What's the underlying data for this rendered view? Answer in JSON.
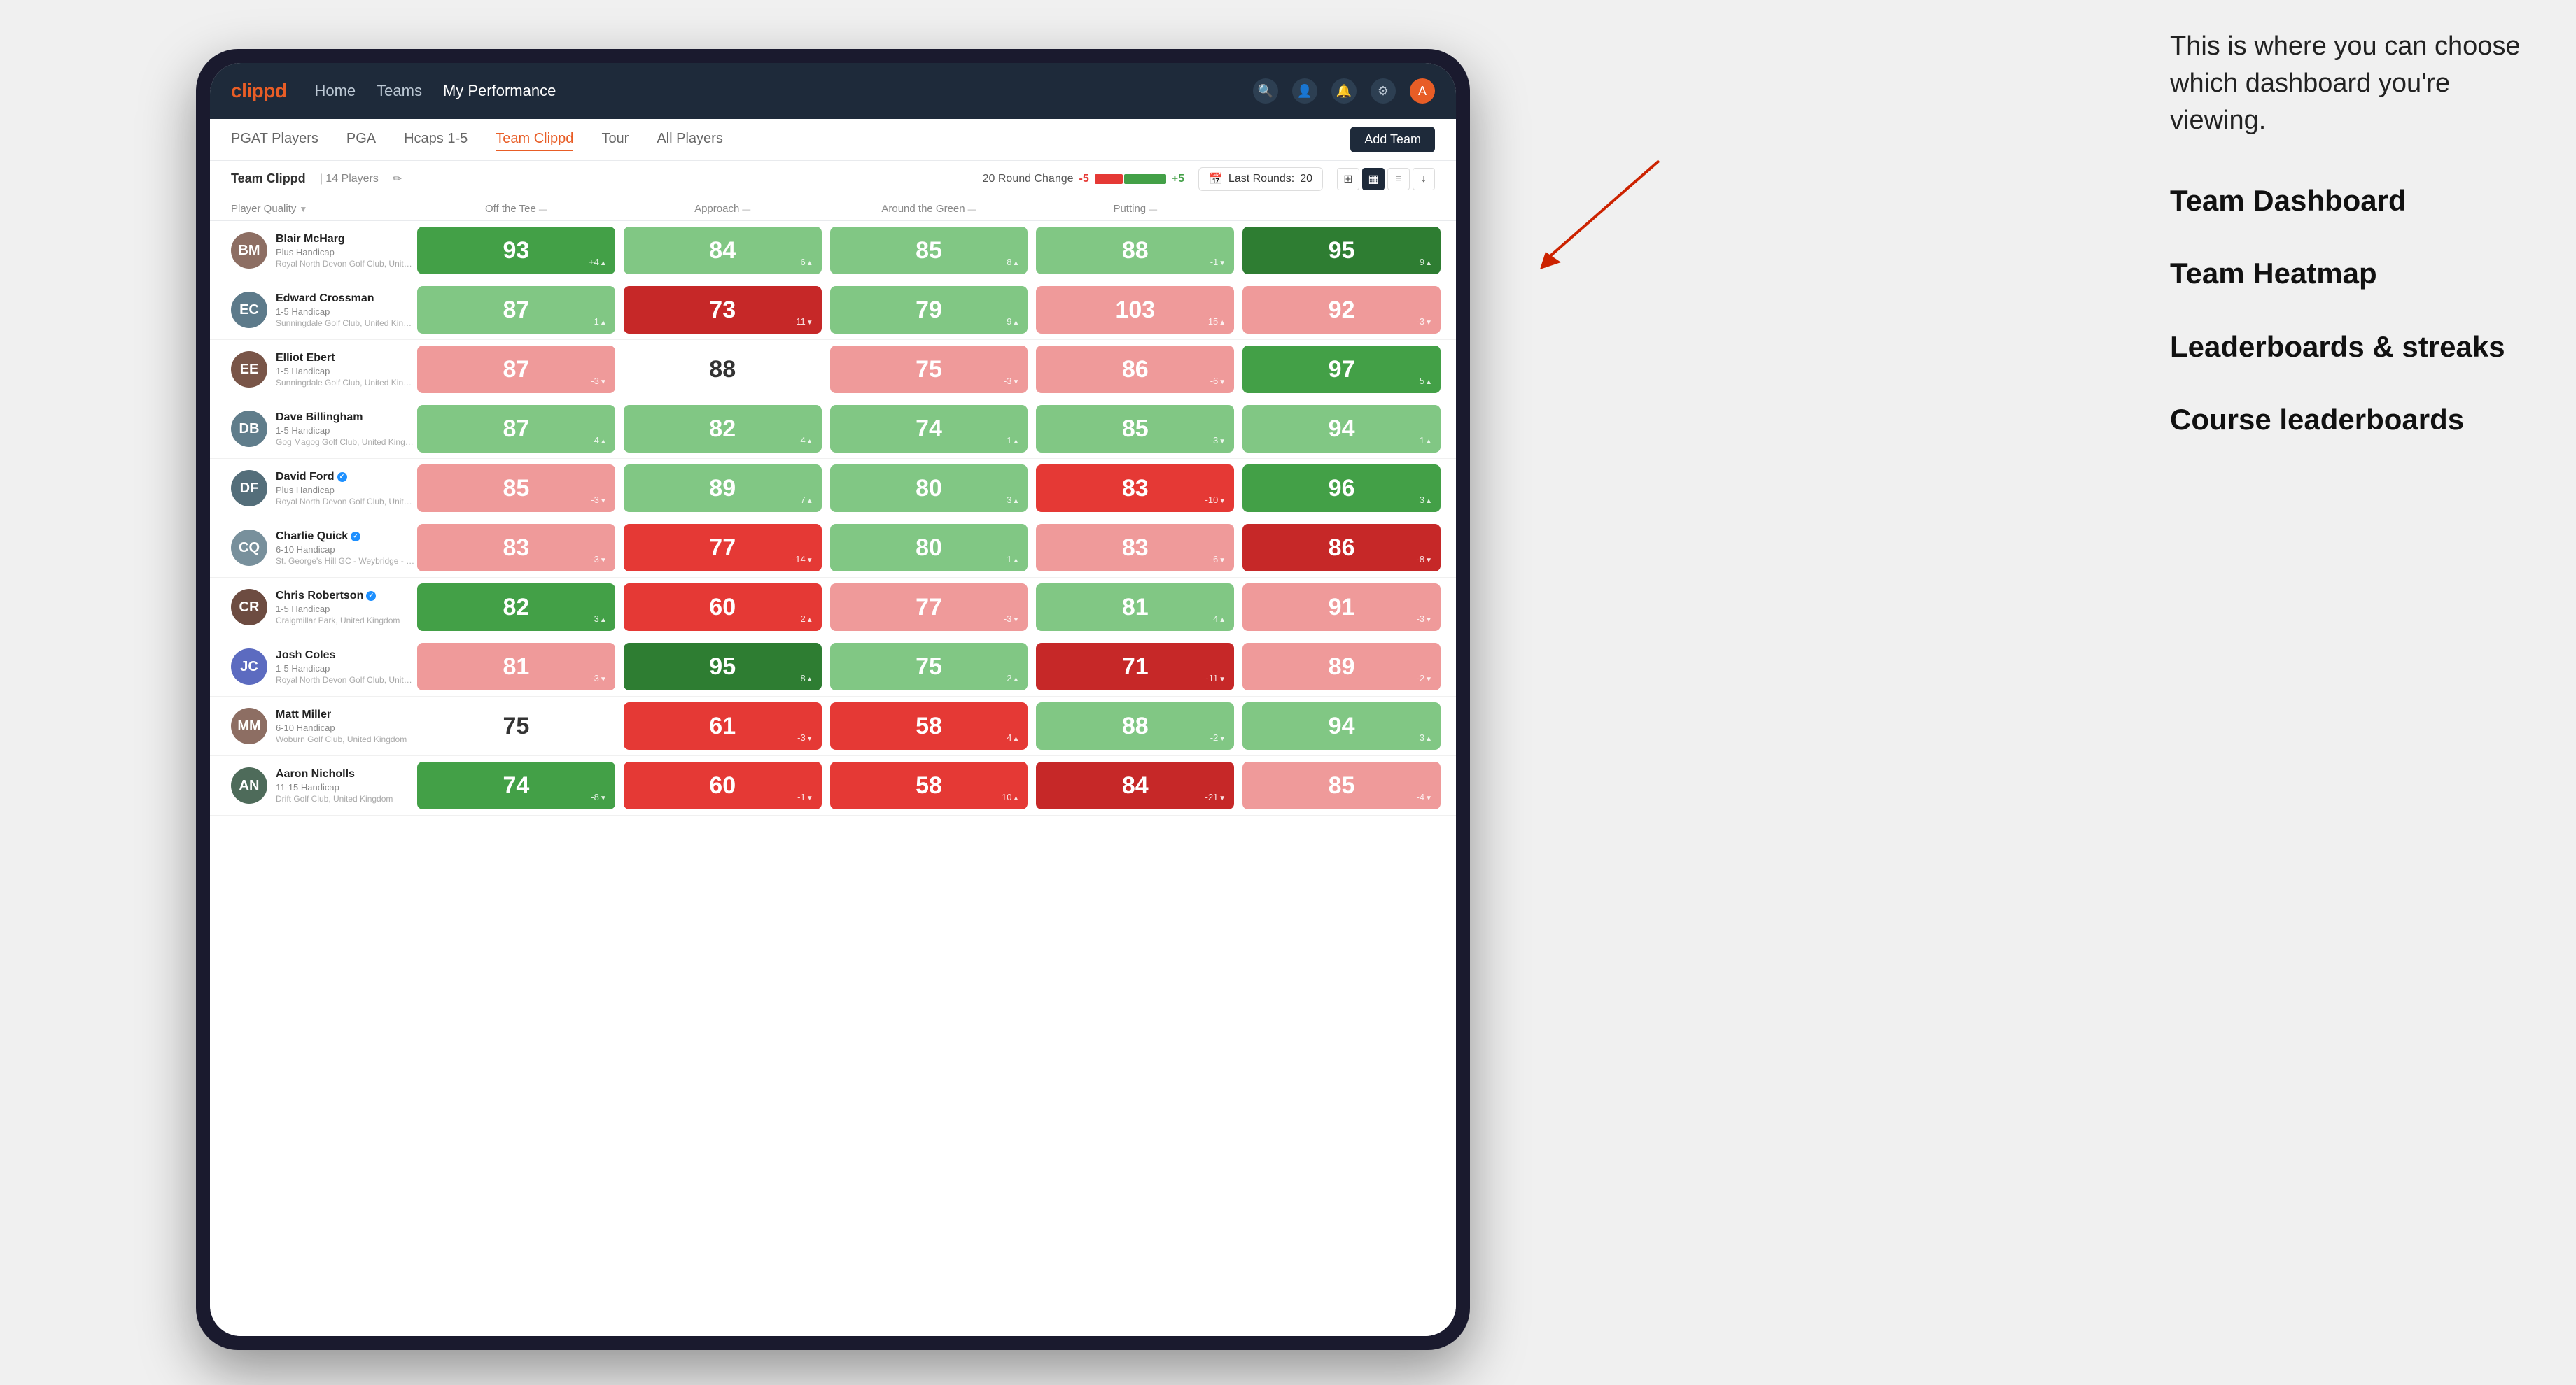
{
  "annotation": {
    "intro": "This is where you can choose which dashboard you're viewing.",
    "options": [
      "Team Dashboard",
      "Team Heatmap",
      "Leaderboards & streaks",
      "Course leaderboards"
    ]
  },
  "nav": {
    "logo": "clippd",
    "items": [
      "Home",
      "Teams",
      "My Performance"
    ],
    "active": "My Performance"
  },
  "sub_nav": {
    "items": [
      "PGAT Players",
      "PGA",
      "Hcaps 1-5",
      "Team Clippd",
      "Tour",
      "All Players"
    ],
    "active": "Team Clippd",
    "add_team_label": "Add Team"
  },
  "team_bar": {
    "name": "Team Clippd",
    "separator": "|",
    "count": "14 Players",
    "round_change_label": "20 Round Change",
    "neg_label": "-5",
    "pos_label": "+5",
    "last_rounds_label": "Last Rounds:",
    "last_rounds_value": "20"
  },
  "columns": [
    "Player Quality ↓",
    "Off the Tee ↓",
    "Approach ↓",
    "Around the Green ↓",
    "Putting ↓"
  ],
  "players": [
    {
      "name": "Blair McHarg",
      "handicap": "Plus Handicap",
      "club": "Royal North Devon Golf Club, United Kingdom",
      "avatar_color": "#8d6e63",
      "initials": "BM",
      "scores": [
        {
          "value": 93,
          "change": "+4",
          "dir": "up",
          "bg": "green-med"
        },
        {
          "value": 84,
          "change": "6",
          "dir": "up",
          "bg": "green-light"
        },
        {
          "value": 85,
          "change": "8",
          "dir": "up",
          "bg": "green-light"
        },
        {
          "value": 88,
          "change": "-1",
          "dir": "down",
          "bg": "green-light"
        },
        {
          "value": 95,
          "change": "9",
          "dir": "up",
          "bg": "green-dark"
        }
      ]
    },
    {
      "name": "Edward Crossman",
      "handicap": "1-5 Handicap",
      "club": "Sunningdale Golf Club, United Kingdom",
      "avatar_color": "#5d7a8a",
      "initials": "EC",
      "scores": [
        {
          "value": 87,
          "change": "1",
          "dir": "up",
          "bg": "green-light"
        },
        {
          "value": 73,
          "change": "-11",
          "dir": "down",
          "bg": "red-dark"
        },
        {
          "value": 79,
          "change": "9",
          "dir": "up",
          "bg": "green-light"
        },
        {
          "value": 103,
          "change": "15",
          "dir": "up",
          "bg": "red-light"
        },
        {
          "value": 92,
          "change": "-3",
          "dir": "down",
          "bg": "red-light"
        }
      ]
    },
    {
      "name": "Elliot Ebert",
      "handicap": "1-5 Handicap",
      "club": "Sunningdale Golf Club, United Kingdom",
      "avatar_color": "#795548",
      "initials": "EE",
      "scores": [
        {
          "value": 87,
          "change": "-3",
          "dir": "down",
          "bg": "red-light"
        },
        {
          "value": 88,
          "change": "",
          "dir": "none",
          "bg": "none"
        },
        {
          "value": 75,
          "change": "-3",
          "dir": "down",
          "bg": "red-light"
        },
        {
          "value": 86,
          "change": "-6",
          "dir": "down",
          "bg": "red-light"
        },
        {
          "value": 97,
          "change": "5",
          "dir": "up",
          "bg": "green-med"
        }
      ]
    },
    {
      "name": "Dave Billingham",
      "handicap": "1-5 Handicap",
      "club": "Gog Magog Golf Club, United Kingdom",
      "avatar_color": "#607d8b",
      "initials": "DB",
      "scores": [
        {
          "value": 87,
          "change": "4",
          "dir": "up",
          "bg": "green-light"
        },
        {
          "value": 82,
          "change": "4",
          "dir": "up",
          "bg": "green-light"
        },
        {
          "value": 74,
          "change": "1",
          "dir": "up",
          "bg": "green-light"
        },
        {
          "value": 85,
          "change": "-3",
          "dir": "down",
          "bg": "green-light"
        },
        {
          "value": 94,
          "change": "1",
          "dir": "up",
          "bg": "green-light"
        }
      ]
    },
    {
      "name": "David Ford",
      "handicap": "Plus Handicap",
      "club": "Royal North Devon Golf Club, United Kingdom",
      "avatar_color": "#546e7a",
      "initials": "DF",
      "verified": true,
      "scores": [
        {
          "value": 85,
          "change": "-3",
          "dir": "down",
          "bg": "red-light"
        },
        {
          "value": 89,
          "change": "7",
          "dir": "up",
          "bg": "green-light"
        },
        {
          "value": 80,
          "change": "3",
          "dir": "up",
          "bg": "green-light"
        },
        {
          "value": 83,
          "change": "-10",
          "dir": "down",
          "bg": "red-med"
        },
        {
          "value": 96,
          "change": "3",
          "dir": "up",
          "bg": "green-med"
        }
      ]
    },
    {
      "name": "Charlie Quick",
      "handicap": "6-10 Handicap",
      "club": "St. George's Hill GC - Weybridge - Surrey, Uni...",
      "avatar_color": "#78909c",
      "initials": "CQ",
      "verified": true,
      "scores": [
        {
          "value": 83,
          "change": "-3",
          "dir": "down",
          "bg": "red-light"
        },
        {
          "value": 77,
          "change": "-14",
          "dir": "down",
          "bg": "red-med"
        },
        {
          "value": 80,
          "change": "1",
          "dir": "up",
          "bg": "green-light"
        },
        {
          "value": 83,
          "change": "-6",
          "dir": "down",
          "bg": "red-light"
        },
        {
          "value": 86,
          "change": "-8",
          "dir": "down",
          "bg": "red-dark"
        }
      ]
    },
    {
      "name": "Chris Robertson",
      "handicap": "1-5 Handicap",
      "club": "Craigmillar Park, United Kingdom",
      "avatar_color": "#6d4c41",
      "initials": "CR",
      "verified": true,
      "scores": [
        {
          "value": 82,
          "change": "3",
          "dir": "up",
          "bg": "green-med"
        },
        {
          "value": 60,
          "change": "2",
          "dir": "up",
          "bg": "red-med"
        },
        {
          "value": 77,
          "change": "-3",
          "dir": "down",
          "bg": "red-light"
        },
        {
          "value": 81,
          "change": "4",
          "dir": "up",
          "bg": "green-light"
        },
        {
          "value": 91,
          "change": "-3",
          "dir": "down",
          "bg": "red-light"
        }
      ]
    },
    {
      "name": "Josh Coles",
      "handicap": "1-5 Handicap",
      "club": "Royal North Devon Golf Club, United Kingdom",
      "avatar_color": "#5c6bc0",
      "initials": "JC",
      "scores": [
        {
          "value": 81,
          "change": "-3",
          "dir": "down",
          "bg": "red-light"
        },
        {
          "value": 95,
          "change": "8",
          "dir": "up",
          "bg": "green-dark"
        },
        {
          "value": 75,
          "change": "2",
          "dir": "up",
          "bg": "green-light"
        },
        {
          "value": 71,
          "change": "-11",
          "dir": "down",
          "bg": "red-dark"
        },
        {
          "value": 89,
          "change": "-2",
          "dir": "down",
          "bg": "red-light"
        }
      ]
    },
    {
      "name": "Matt Miller",
      "handicap": "6-10 Handicap",
      "club": "Woburn Golf Club, United Kingdom",
      "avatar_color": "#8d6e63",
      "initials": "MM",
      "scores": [
        {
          "value": 75,
          "change": "",
          "dir": "none",
          "bg": "none"
        },
        {
          "value": 61,
          "change": "-3",
          "dir": "down",
          "bg": "red-med"
        },
        {
          "value": 58,
          "change": "4",
          "dir": "up",
          "bg": "red-med"
        },
        {
          "value": 88,
          "change": "-2",
          "dir": "down",
          "bg": "green-light"
        },
        {
          "value": 94,
          "change": "3",
          "dir": "up",
          "bg": "green-light"
        }
      ]
    },
    {
      "name": "Aaron Nicholls",
      "handicap": "11-15 Handicap",
      "club": "Drift Golf Club, United Kingdom",
      "avatar_color": "#4e6b5a",
      "initials": "AN",
      "scores": [
        {
          "value": 74,
          "change": "-8",
          "dir": "down",
          "bg": "green-med"
        },
        {
          "value": 60,
          "change": "-1",
          "dir": "down",
          "bg": "red-med"
        },
        {
          "value": 58,
          "change": "10",
          "dir": "up",
          "bg": "red-med"
        },
        {
          "value": 84,
          "change": "-21",
          "dir": "down",
          "bg": "red-dark"
        },
        {
          "value": 85,
          "change": "-4",
          "dir": "down",
          "bg": "red-light"
        }
      ]
    }
  ]
}
